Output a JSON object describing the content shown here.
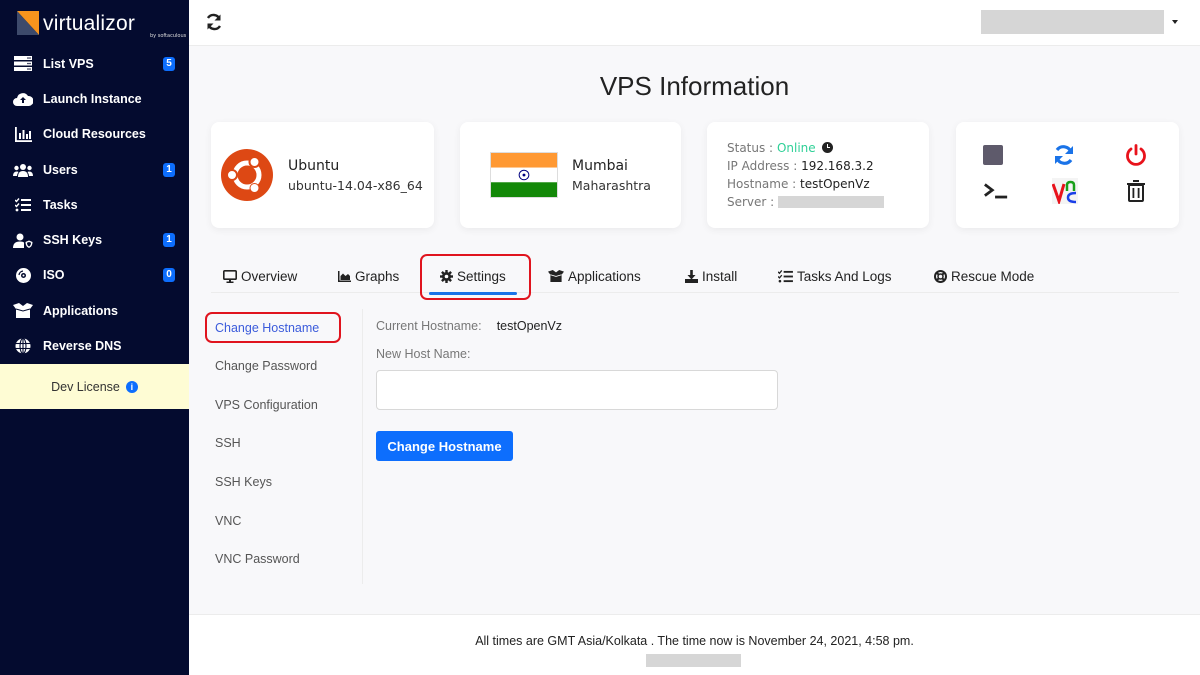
{
  "brand": {
    "name": "virtualizor",
    "sub": "by softaculous",
    "accent": "#f7941d"
  },
  "sidebar": {
    "items": [
      {
        "label": "List VPS",
        "icon": "server-list-icon",
        "badge": "5"
      },
      {
        "label": "Launch Instance",
        "icon": "cloud-upload-icon",
        "badge": null
      },
      {
        "label": "Cloud Resources",
        "icon": "bar-chart-icon",
        "badge": null
      },
      {
        "label": "Users",
        "icon": "users-icon",
        "badge": "1"
      },
      {
        "label": "Tasks",
        "icon": "tasks-icon",
        "badge": null
      },
      {
        "label": "SSH Keys",
        "icon": "user-shield-icon",
        "badge": "1"
      },
      {
        "label": "ISO",
        "icon": "disc-icon",
        "badge": "0"
      },
      {
        "label": "Applications",
        "icon": "box-open-icon",
        "badge": null
      },
      {
        "label": "Reverse DNS",
        "icon": "globe-icon",
        "badge": null
      }
    ],
    "license": "Dev License"
  },
  "topbar": {
    "refresh_icon": "refresh-icon"
  },
  "page": {
    "title": "VPS Information"
  },
  "os_card": {
    "name": "Ubuntu",
    "version": "ubuntu-14.04-x86_64"
  },
  "location_card": {
    "city": "Mumbai",
    "state": "Maharashtra",
    "flag": "india-flag"
  },
  "status_card": {
    "status_label": "Status :",
    "status_value": "Online",
    "ip_label": "IP Address :",
    "ip_value": "192.168.3.2",
    "hostname_label": "Hostname :",
    "hostname_value": "testOpenVz",
    "server_label": "Server :"
  },
  "actions": [
    {
      "name": "stop",
      "icon": "stop-icon",
      "color": "#5e5a6b"
    },
    {
      "name": "restart",
      "icon": "restart-icon",
      "color": "#1a73e8"
    },
    {
      "name": "poweroff",
      "icon": "power-icon",
      "color": "#e8121b"
    },
    {
      "name": "console",
      "icon": "terminal-icon",
      "color": "#222222"
    },
    {
      "name": "vnc",
      "icon": "vnc-icon",
      "color": "#e8121b"
    },
    {
      "name": "delete",
      "icon": "trash-icon",
      "color": "#222222"
    }
  ],
  "tabs": [
    {
      "label": "Overview",
      "icon": "monitor-icon"
    },
    {
      "label": "Graphs",
      "icon": "area-chart-icon"
    },
    {
      "label": "Settings",
      "icon": "gear-icon",
      "active": true
    },
    {
      "label": "Applications",
      "icon": "box-open-icon"
    },
    {
      "label": "Install",
      "icon": "download-icon"
    },
    {
      "label": "Tasks And Logs",
      "icon": "tasks-icon"
    },
    {
      "label": "Rescue Mode",
      "icon": "life-ring-icon"
    }
  ],
  "settings_nav": [
    {
      "label": "Change Hostname",
      "active": true
    },
    {
      "label": "Change Password"
    },
    {
      "label": "VPS Configuration"
    },
    {
      "label": "SSH"
    },
    {
      "label": "SSH Keys"
    },
    {
      "label": "VNC"
    },
    {
      "label": "VNC Password"
    }
  ],
  "form": {
    "current_label": "Current Hostname:",
    "current_value": "testOpenVz",
    "new_label": "New Host Name:",
    "new_value": "",
    "submit_label": "Change Hostname"
  },
  "footer": {
    "text": "All times are GMT Asia/Kolkata . The time now is November 24, 2021, 4:58 pm."
  }
}
